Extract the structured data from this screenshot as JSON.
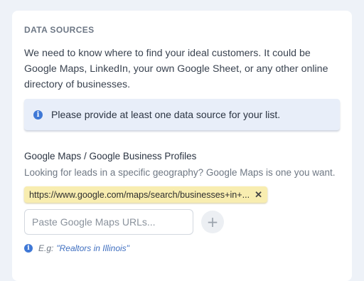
{
  "section": {
    "title": "DATA SOURCES",
    "description": "We need to know where to find your ideal customers. It could be Google Maps, LinkedIn, your own Google Sheet, or any other online directory of businesses."
  },
  "banner": {
    "icon": "info-icon",
    "text": "Please provide at least one data source for your list."
  },
  "google_maps": {
    "label": "Google Maps / Google Business Profiles",
    "help": "Looking for leads in a specific geography? Google Maps is one you want.",
    "tags": [
      {
        "text": "https://www.google.com/maps/search/businesses+in+...",
        "remove_icon": "close-icon"
      }
    ],
    "input_placeholder": "Paste Google Maps URLs...",
    "input_value": "",
    "add_button_label": "+",
    "hint_prefix": "E.g:",
    "hint_example": "\"Realtors in Illinois\""
  },
  "colors": {
    "accent": "#3f78d6",
    "tag_bg": "#f8edb0",
    "banner_bg": "#e8eef9"
  }
}
